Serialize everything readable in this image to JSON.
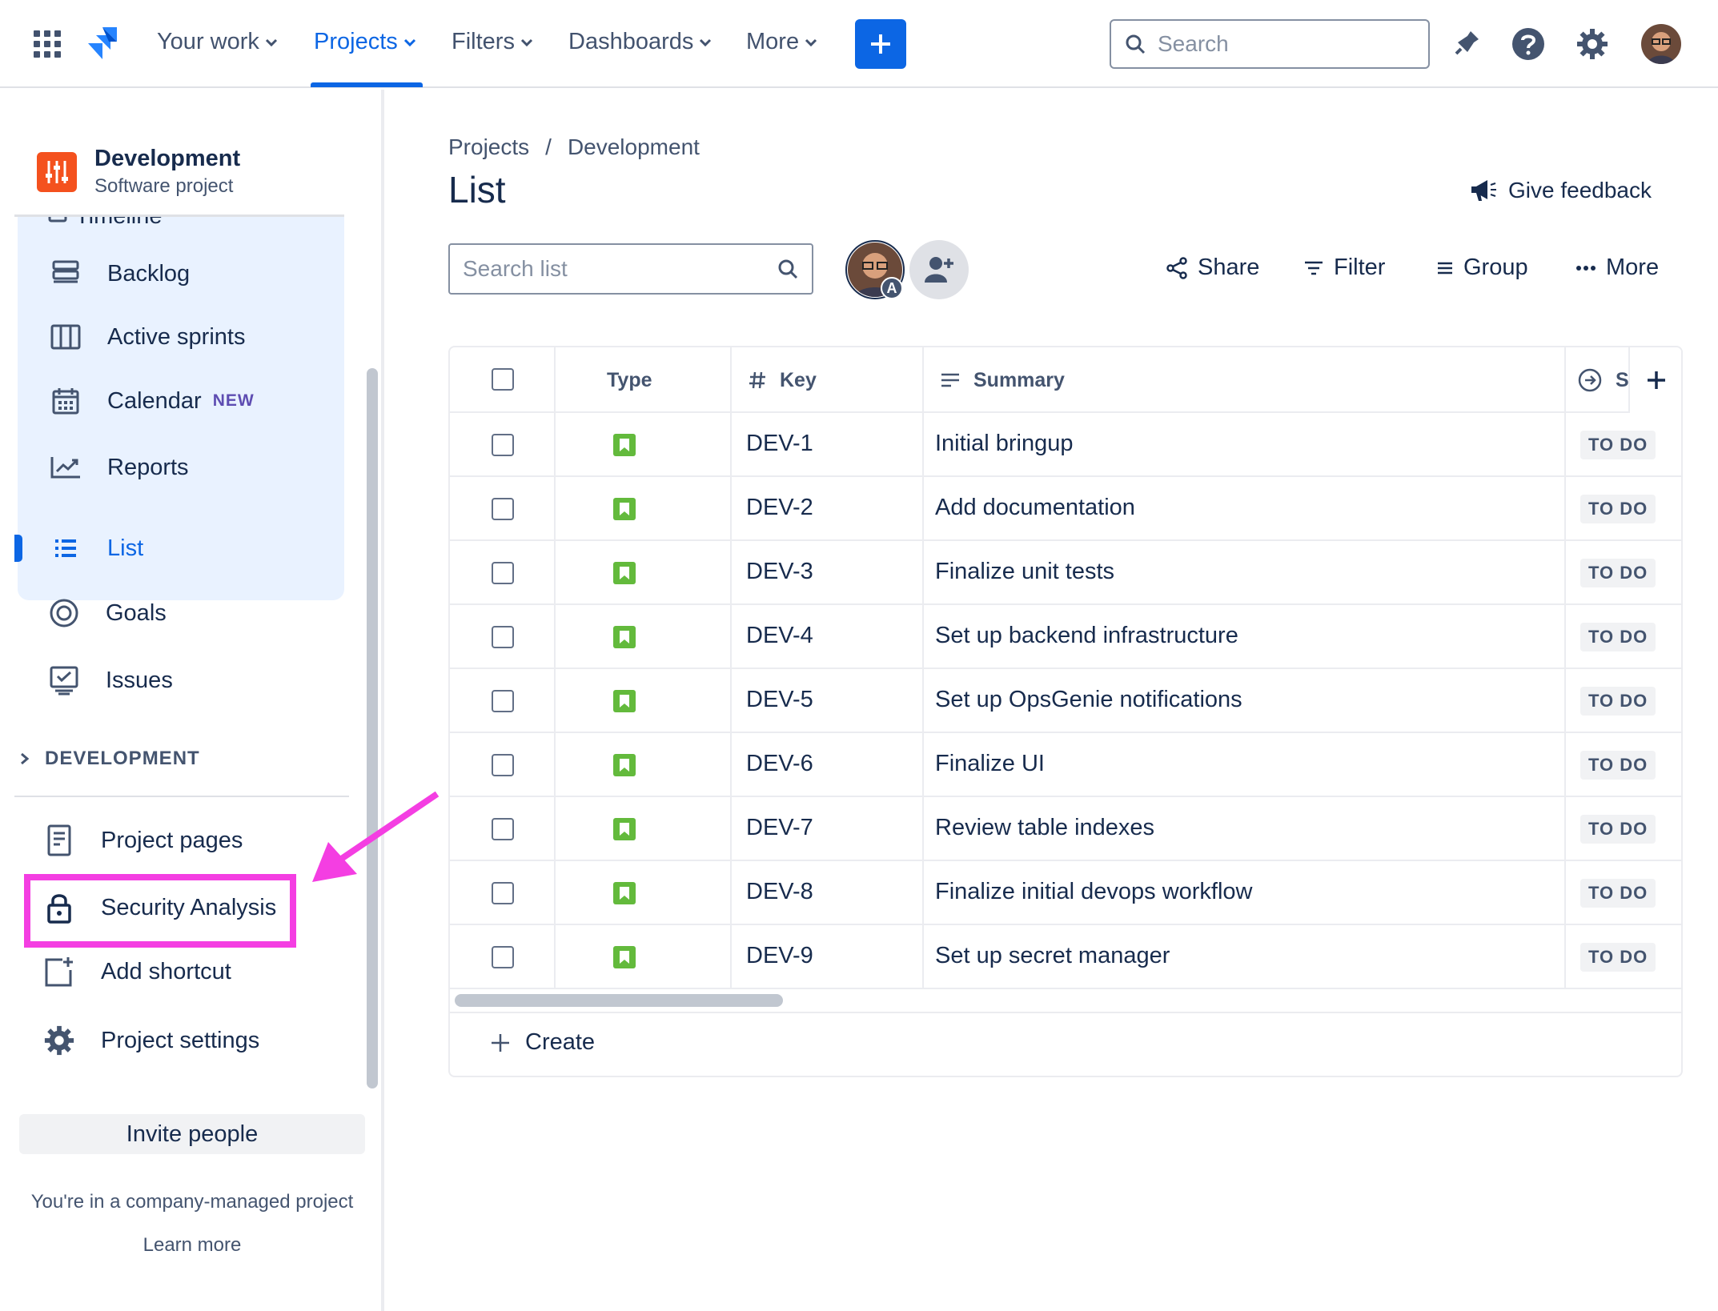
{
  "topnav": {
    "items": [
      {
        "label": "Your work"
      },
      {
        "label": "Projects"
      },
      {
        "label": "Filters"
      },
      {
        "label": "Dashboards"
      },
      {
        "label": "More"
      }
    ],
    "search_placeholder": "Search",
    "accent": "#0c66e4"
  },
  "sidebar": {
    "project_name": "Development",
    "project_type": "Software project",
    "cut_item": "Timeline",
    "planning_items": [
      {
        "label": "Backlog",
        "icon": "backlog-icon"
      },
      {
        "label": "Active sprints",
        "icon": "board-icon"
      },
      {
        "label": "Calendar",
        "icon": "calendar-icon",
        "badge": "NEW"
      },
      {
        "label": "Reports",
        "icon": "reports-icon"
      }
    ],
    "list_item": "List",
    "other_items": [
      {
        "label": "Goals",
        "icon": "goals-icon"
      },
      {
        "label": "Issues",
        "icon": "issues-icon"
      }
    ],
    "section_label": "DEVELOPMENT",
    "bottom_items": [
      {
        "label": "Project pages",
        "icon": "page-icon"
      },
      {
        "label": "Security Analysis",
        "icon": "lock-icon"
      },
      {
        "label": "Add shortcut",
        "icon": "add-shortcut-icon"
      },
      {
        "label": "Project settings",
        "icon": "gear-icon"
      }
    ],
    "invite_label": "Invite people",
    "managed_text": "You're in a company-managed project",
    "learn_more": "Learn more"
  },
  "main": {
    "breadcrumb": [
      "Projects",
      "/",
      "Development"
    ],
    "title": "List",
    "feedback": "Give feedback",
    "search_placeholder": "Search list",
    "avatar_badge": "A",
    "tools": [
      {
        "label": "Share"
      },
      {
        "label": "Filter"
      },
      {
        "label": "Group"
      },
      {
        "label": "More"
      }
    ]
  },
  "table": {
    "columns": [
      "Type",
      "Key",
      "Summary",
      "S"
    ],
    "rows": [
      {
        "key": "DEV-1",
        "summary": "Initial bringup",
        "status": "TO DO"
      },
      {
        "key": "DEV-2",
        "summary": "Add documentation",
        "status": "TO DO"
      },
      {
        "key": "DEV-3",
        "summary": "Finalize unit tests",
        "status": "TO DO"
      },
      {
        "key": "DEV-4",
        "summary": "Set up backend infrastructure",
        "status": "TO DO"
      },
      {
        "key": "DEV-5",
        "summary": "Set up OpsGenie notifications",
        "status": "TO DO"
      },
      {
        "key": "DEV-6",
        "summary": "Finalize UI",
        "status": "TO DO"
      },
      {
        "key": "DEV-7",
        "summary": "Review table indexes",
        "status": "TO DO"
      },
      {
        "key": "DEV-8",
        "summary": "Finalize initial devops workflow",
        "status": "TO DO"
      },
      {
        "key": "DEV-9",
        "summary": "Set up secret manager",
        "status": "TO DO"
      }
    ],
    "create_label": "Create"
  },
  "annotation": {
    "color": "#f43ee2"
  }
}
